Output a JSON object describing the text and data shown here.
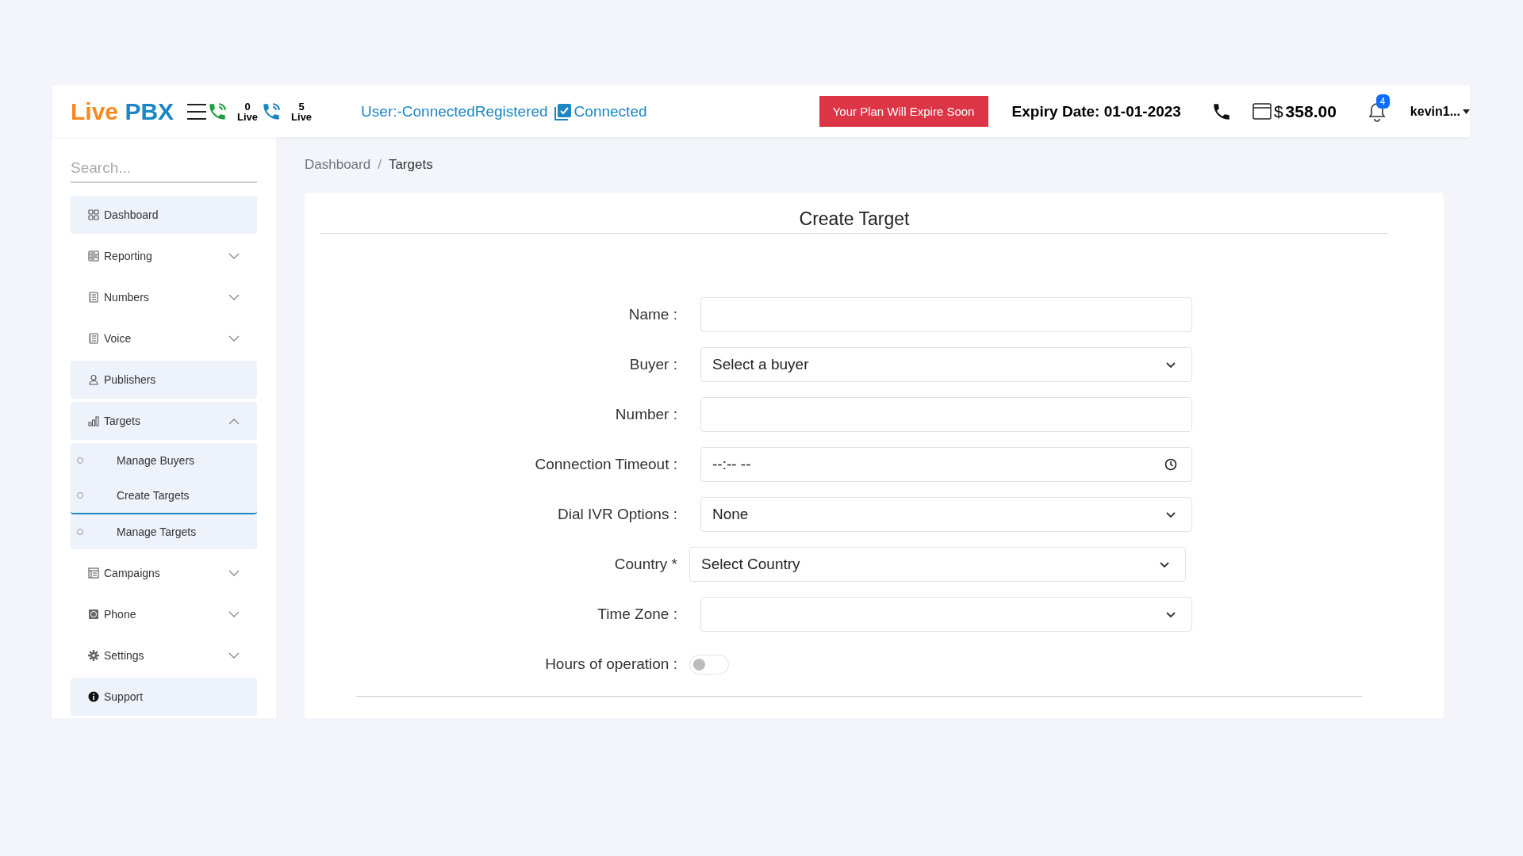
{
  "header": {
    "logo": {
      "part_1": "Live",
      "part_2": "PBX"
    },
    "live_counters": [
      {
        "count": "0",
        "label": "Live"
      },
      {
        "count": "5",
        "label": "Live"
      }
    ],
    "user_status": "User:-ConnectedRegistered",
    "connection": {
      "label": "Connected",
      "checked": true
    },
    "plan_alert": "Your Plan Will Expire Soon",
    "expiry": "Expiry Date: 01-01-2023",
    "currency": "$",
    "balance": "358.00",
    "notifications": "4",
    "user": "kevin1..."
  },
  "sidebar": {
    "search": {
      "placeholder": "Search..."
    },
    "items": [
      {
        "label": "Dashboard",
        "highlighted": true
      },
      {
        "label": "Reporting",
        "highlighted": false,
        "expanded": false
      },
      {
        "label": "Numbers",
        "highlighted": false,
        "expanded": false
      },
      {
        "label": "Voice",
        "highlighted": false,
        "expanded": false
      },
      {
        "label": "Publishers",
        "highlighted": true
      },
      {
        "label": "Targets",
        "highlighted": true,
        "expanded": true,
        "children": [
          {
            "label": "Manage Buyers",
            "selected": false
          },
          {
            "label": "Create Targets",
            "selected": true
          },
          {
            "label": "Manage Targets",
            "selected": false
          }
        ]
      },
      {
        "label": "Campaigns",
        "highlighted": false,
        "expanded": false
      },
      {
        "label": "Phone",
        "highlighted": false,
        "expanded": false
      },
      {
        "label": "Settings",
        "highlighted": false,
        "expanded": false
      },
      {
        "label": "Support",
        "highlighted": true
      }
    ]
  },
  "breadcrumb": {
    "separator": "/",
    "items": [
      {
        "label": "Dashboard",
        "selected": false
      },
      {
        "label": "Targets",
        "selected": true
      }
    ]
  },
  "form": {
    "title": "Create Target",
    "fields": [
      {
        "label": "Name :",
        "kind": "text"
      },
      {
        "label": "Buyer :",
        "kind": "select",
        "value": "Select a buyer"
      },
      {
        "label": "Number :",
        "kind": "text"
      },
      {
        "label": "Connection Timeout :",
        "kind": "time",
        "value": "--:-- --"
      },
      {
        "label": "Dial IVR Options :",
        "kind": "select",
        "value": "None"
      },
      {
        "label": "Country *",
        "kind": "select",
        "value": "Select Country",
        "offset": true
      },
      {
        "label": "Time Zone :",
        "kind": "select"
      },
      {
        "label": "Hours of operation :",
        "kind": "toggle",
        "on": false
      }
    ]
  }
}
